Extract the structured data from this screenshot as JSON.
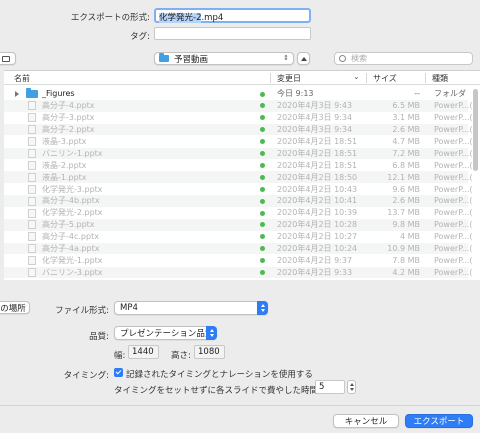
{
  "export": {
    "filename_label": "エクスポートの形式:",
    "filename_sel": "化学発光-2",
    "filename_ext": ".mp4",
    "tags_label": "タグ:",
    "tags_value": ""
  },
  "toolbar": {
    "location": "予習動画",
    "search_placeholder": "検索"
  },
  "columns": {
    "name": "名前",
    "date": "変更日",
    "size": "サイズ",
    "kind": "種類"
  },
  "files": [
    {
      "name": "_Figures",
      "date": "今日 9:13",
      "size": "--",
      "kind": "フォルダ",
      "folder": true
    },
    {
      "name": "高分子-4.pptx",
      "date": "2020年4月3日 9:43",
      "size": "6.5 MB",
      "kind": "PowerP...("
    },
    {
      "name": "高分子-3.pptx",
      "date": "2020年4月3日 9:34",
      "size": "3.1 MB",
      "kind": "PowerP...("
    },
    {
      "name": "高分子-2.pptx",
      "date": "2020年4月3日 9:34",
      "size": "2.6 MB",
      "kind": "PowerP...("
    },
    {
      "name": "液晶-3.pptx",
      "date": "2020年4月2日 18:51",
      "size": "4.7 MB",
      "kind": "PowerP...("
    },
    {
      "name": "バニリン-1.pptx",
      "date": "2020年4月2日 18:51",
      "size": "7.2 MB",
      "kind": "PowerP...("
    },
    {
      "name": "液晶-2.pptx",
      "date": "2020年4月2日 18:51",
      "size": "6.8 MB",
      "kind": "PowerP...("
    },
    {
      "name": "液晶-1.pptx",
      "date": "2020年4月2日 18:50",
      "size": "12.1 MB",
      "kind": "PowerP...("
    },
    {
      "name": "化学発光-3.pptx",
      "date": "2020年4月2日 10:43",
      "size": "9.6 MB",
      "kind": "PowerP...("
    },
    {
      "name": "高分子-4b.pptx",
      "date": "2020年4月2日 10:41",
      "size": "2.6 MB",
      "kind": "PowerP...("
    },
    {
      "name": "化学発光-2.pptx",
      "date": "2020年4月2日 10:39",
      "size": "13.7 MB",
      "kind": "PowerP...("
    },
    {
      "name": "高分子-5.pptx",
      "date": "2020年4月2日 10:28",
      "size": "9.8 MB",
      "kind": "PowerP...("
    },
    {
      "name": "高分子-4c.pptx",
      "date": "2020年4月2日 10:27",
      "size": "4 MB",
      "kind": "PowerP...("
    },
    {
      "name": "高分子-4a.pptx",
      "date": "2020年4月2日 10:24",
      "size": "10.9 MB",
      "kind": "PowerP...("
    },
    {
      "name": "化学発光-1.pptx",
      "date": "2020年4月2日 9:37",
      "size": "7.8 MB",
      "kind": "PowerP...("
    },
    {
      "name": "バニリン-3.pptx",
      "date": "2020年4月2日 9:33",
      "size": "4.2 MB",
      "kind": "PowerP...("
    }
  ],
  "options": {
    "location_button": "の場所",
    "format_label": "ファイル形式:",
    "format_value": "MP4",
    "quality_label": "品質:",
    "quality_value": "プレゼンテーション品質",
    "width_label": "幅:",
    "width_value": "1440",
    "height_label": "高さ:",
    "height_value": "1080",
    "timing_label": "タイミング:",
    "timing_checkbox": "記録されたタイミングとナレーションを使用する",
    "seconds_label": "タイミングをセットせずに各スライドで費やした時間 (秒):",
    "seconds_value": "5"
  },
  "buttons": {
    "cancel": "キャンセル",
    "export": "エクスポート"
  },
  "colors": {
    "accent": "#2f7df6",
    "status_dot": "#4cba52",
    "folder": "#3fa0e8"
  }
}
